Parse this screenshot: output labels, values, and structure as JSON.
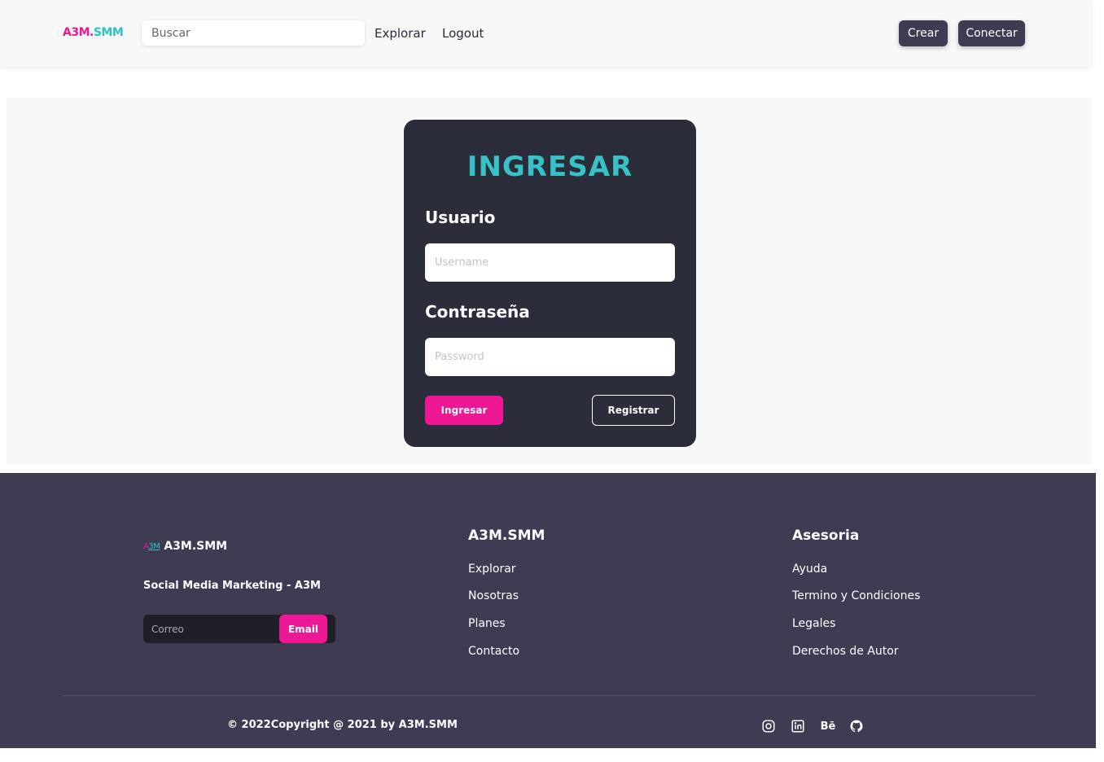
{
  "header": {
    "brand_part1": "A3M.",
    "brand_part2": "SMM",
    "search_placeholder": "Buscar",
    "nav": [
      "Explorar",
      "Logout"
    ],
    "buttons": {
      "create": "Crear",
      "connect": "Conectar"
    }
  },
  "login": {
    "title": "INGRESAR",
    "user_label": "Usuario",
    "user_placeholder": "Username",
    "password_label": "Contraseña",
    "password_placeholder": "Password",
    "submit": "Ingresar",
    "register": "Registrar"
  },
  "footer": {
    "logo_mark_a": "A",
    "logo_mark_b": "3M",
    "logo_text": "A3M.SMM",
    "tagline": "Social Media Marketing - A3M",
    "email_placeholder": "Correo",
    "email_button": "Email",
    "col1": {
      "title": "A3M.SMM",
      "links": [
        "Explorar",
        "Nosotras",
        "Planes",
        "Contacto"
      ]
    },
    "col2": {
      "title": "Asesoria",
      "links": [
        "Ayuda",
        "Termino y Condiciones",
        "Legales",
        "Derechos de Autor"
      ]
    },
    "copyright": "© 2022Copyright @ 2021 by A3M.SMM",
    "social": [
      "instagram-icon",
      "linkedin-icon",
      "behance-icon",
      "github-icon"
    ],
    "behance_text": "Bē"
  },
  "colors": {
    "accent_pink": "#ee1894",
    "accent_cyan": "#36c2c6",
    "card_bg": "#2b2d3a",
    "footer_bg": "#3f3b52"
  }
}
